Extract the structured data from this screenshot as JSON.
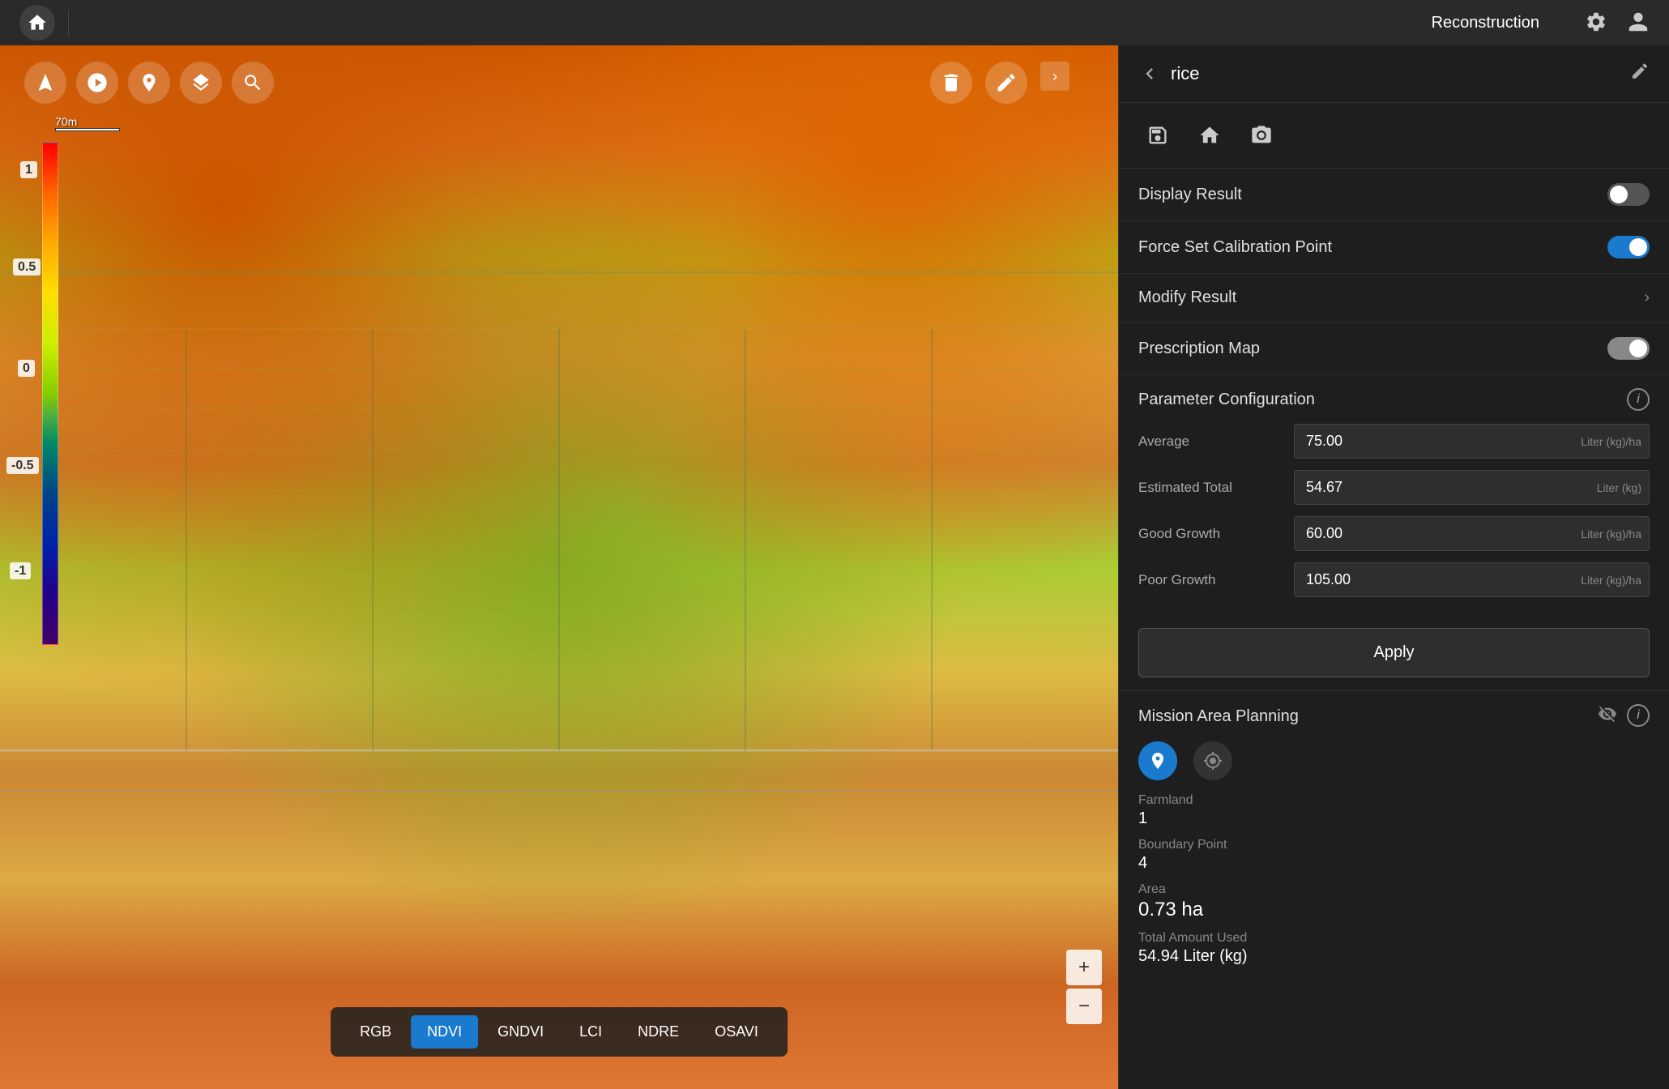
{
  "topbar": {
    "title": "Reconstruction",
    "home_icon": "home-icon",
    "gear_icon": "gear-icon",
    "user_icon": "user-icon"
  },
  "panel": {
    "back_label": "‹",
    "project_name": "rice",
    "edit_icon": "edit-icon",
    "action_save": "save-icon",
    "action_home": "home-icon",
    "action_photo": "photo-icon"
  },
  "display_result": {
    "label": "Display Result",
    "toggle_state": "off"
  },
  "force_calibration": {
    "label": "Force Set Calibration Point",
    "toggle_state": "on"
  },
  "modify_result": {
    "label": "Modify Result"
  },
  "prescription_map": {
    "label": "Prescription Map",
    "toggle_state": "on-gray"
  },
  "parameter_config": {
    "title": "Parameter Configuration",
    "params": [
      {
        "label": "Average",
        "value": "75.00",
        "unit": "Liter (kg)/ha"
      },
      {
        "label": "Estimated Total",
        "value": "54.67",
        "unit": "Liter (kg)"
      },
      {
        "label": "Good Growth",
        "value": "60.00",
        "unit": "Liter (kg)/ha"
      },
      {
        "label": "Poor Growth",
        "value": "105.00",
        "unit": "Liter (kg)/ha"
      }
    ],
    "apply_label": "Apply"
  },
  "mission_area": {
    "title": "Mission Area Planning",
    "farmland_label": "Farmland",
    "farmland_value": "1",
    "boundary_label": "Boundary Point",
    "boundary_value": "4",
    "area_label": "Area",
    "area_value": "0.73 ha",
    "total_amount_label": "Total Amount Used",
    "total_amount_value": "54.94 Liter (kg)"
  },
  "map": {
    "scale_labels": [
      "1",
      "0.5",
      "0",
      "-0.5",
      "-1"
    ],
    "layers": [
      "RGB",
      "NDVI",
      "GNDVI",
      "LCI",
      "NDRE",
      "OSAVI"
    ],
    "active_layer": "NDVI",
    "zoom_in": "+",
    "zoom_out": "−"
  }
}
